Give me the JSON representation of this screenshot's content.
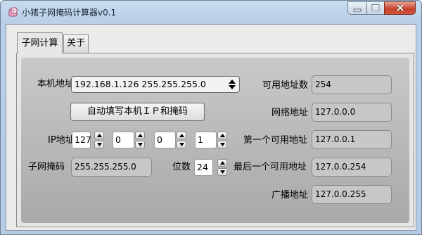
{
  "window": {
    "title": "小猪子网掩码计算器v0.1"
  },
  "tabs": [
    {
      "label": "子网计算"
    },
    {
      "label": "关于"
    }
  ],
  "form": {
    "local_address_label": "本机地址",
    "local_address_value": "192.168.1.126 255.255.255.0",
    "autofill_button": "自动填写本机ＩＰ和掩码",
    "ip_label": "IP地址",
    "ip_octets": [
      "127",
      "0",
      "0",
      "1"
    ],
    "mask_label": "子网掩码",
    "mask_value": "255.255.255.0",
    "bits_label": "位数",
    "bits_value": "24"
  },
  "results": {
    "available_count_label": "可用地址数",
    "available_count_value": "254",
    "network_label": "网络地址",
    "network_value": "127.0.0.0",
    "first_label": "第一个可用地址",
    "first_value": "127.0.0.1",
    "last_label": "最后一个可用地址",
    "last_value": "127.0.0.254",
    "broadcast_label": "广播地址",
    "broadcast_value": "127.0.0.255"
  }
}
